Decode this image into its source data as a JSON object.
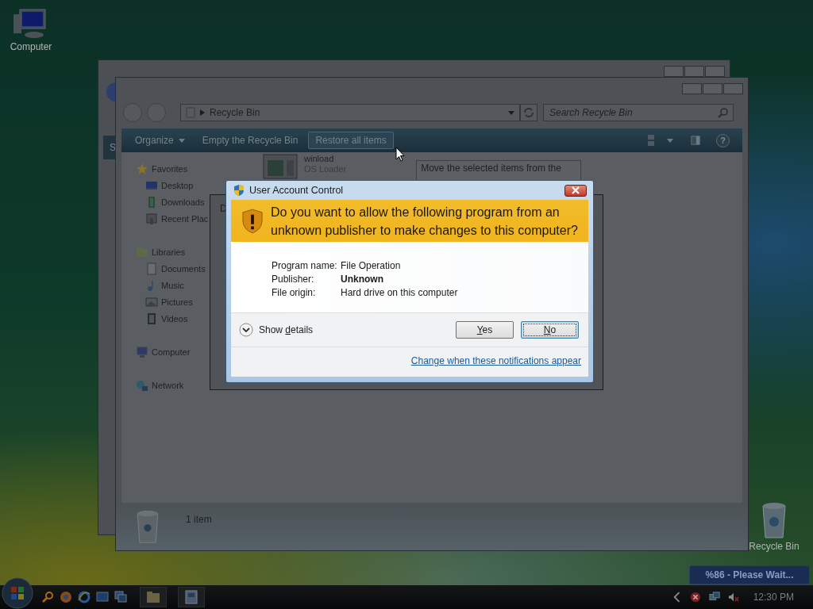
{
  "desktop_icons": [
    {
      "label": "Computer",
      "kind": "computer"
    },
    {
      "label": "Recycle Bin",
      "kind": "recycle"
    }
  ],
  "back_window": {
    "toolbar_text": "S"
  },
  "explorer": {
    "address": "Recycle Bin",
    "search": {
      "placeholder": "Search Recycle Bin"
    },
    "toolbar": [
      {
        "label": "Organize",
        "kind": "menu",
        "hovered": false
      },
      {
        "label": "Empty the Recycle Bin",
        "kind": "button",
        "hovered": false
      },
      {
        "label": "Restore all items",
        "kind": "button",
        "hovered": true
      }
    ],
    "help": "?",
    "nav": [
      {
        "label": "Favorites",
        "kind": "star",
        "children": [
          {
            "label": "Desktop",
            "kind": "desktop"
          },
          {
            "label": "Downloads",
            "kind": "downloads"
          },
          {
            "label": "Recent Plac",
            "kind": "recent"
          }
        ]
      },
      {
        "label": "Libraries",
        "kind": "libraries",
        "children": [
          {
            "label": "Documents",
            "kind": "documents"
          },
          {
            "label": "Music",
            "kind": "music"
          },
          {
            "label": "Pictures",
            "kind": "pictures"
          },
          {
            "label": "Videos",
            "kind": "videos"
          }
        ]
      },
      {
        "label": "Computer",
        "kind": "computer"
      },
      {
        "label": "Network",
        "kind": "network"
      }
    ],
    "files": [
      {
        "name": "winload",
        "type": "OS Loader"
      }
    ],
    "tooltip": "Move the selected items from the",
    "status": "1 item"
  },
  "file_dialog": {
    "title": "D"
  },
  "uac": {
    "title": "User Account Control",
    "heading": "Do you want to allow the following program from an unknown publisher to make changes to this computer?",
    "details": [
      {
        "label": "Program name:",
        "value": "File Operation",
        "bold": false
      },
      {
        "label": "Publisher:",
        "value": "Unknown",
        "bold": true
      },
      {
        "label": "File origin:",
        "value": "Hard drive on this computer",
        "bold": false
      }
    ],
    "show_details": {
      "before": "Show ",
      "key": "d",
      "after": "etails"
    },
    "buttons": [
      {
        "key": "Y",
        "after": "es",
        "focused": false
      },
      {
        "key": "N",
        "after": "o",
        "focused": true
      }
    ],
    "link": "Change when these notifications appear"
  },
  "notification": "%86 - Please Wait...",
  "taskbar": {
    "quick_launch": [
      {
        "kind": "search"
      },
      {
        "kind": "browser"
      },
      {
        "kind": "ie"
      },
      {
        "kind": "desktop"
      },
      {
        "kind": "switch"
      }
    ],
    "tasks": [
      {
        "kind": "folder"
      },
      {
        "kind": "program"
      }
    ],
    "clock": "12:30 PM"
  }
}
